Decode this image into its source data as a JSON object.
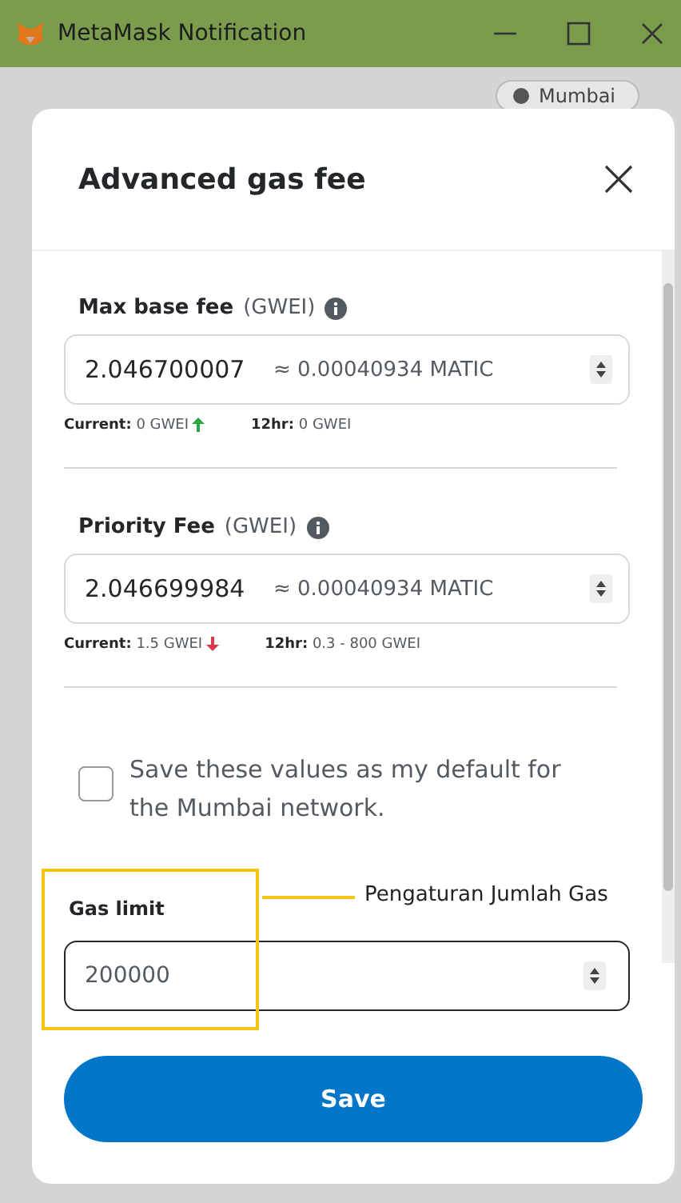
{
  "window": {
    "title": "MetaMask Notification"
  },
  "network_pill": {
    "label": "Mumbai"
  },
  "dialog": {
    "title": "Advanced gas fee",
    "fees": [
      {
        "label": "Max base fee",
        "unit": "(GWEI)",
        "value": "2.046700007",
        "conversion": "≈ 0.00040934 MATIC",
        "current_label": "Current:",
        "current_value": "0 GWEI",
        "rising": true,
        "range_label": "12hr:",
        "range_value": "0 GWEI"
      },
      {
        "label": "Priority Fee",
        "unit": "(GWEI)",
        "value": "2.046699984",
        "conversion": "≈ 0.00040934 MATIC",
        "current_label": "Current:",
        "current_value": "1.5 GWEI",
        "rising": false,
        "range_label": "12hr:",
        "range_value": "0.3 - 800 GWEI"
      }
    ],
    "default_checkbox": {
      "label": "Save these values as my default for the Mumbai network.",
      "checked": false
    },
    "gas_limit": {
      "label": "Gas limit",
      "value": "200000"
    },
    "save_button": "Save"
  },
  "annotation": {
    "text": "Pengaturan Jumlah Gas"
  }
}
